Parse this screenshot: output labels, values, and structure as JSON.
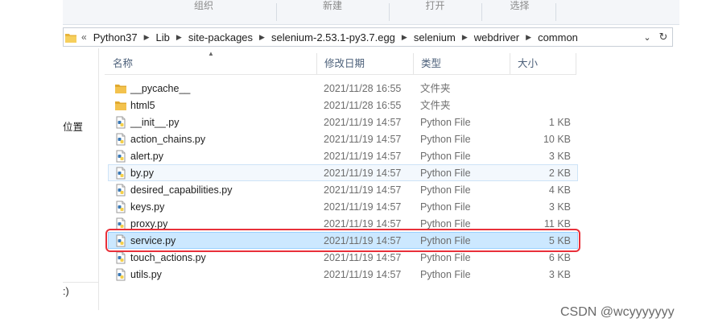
{
  "ribbon": {
    "groups": [
      {
        "label": "组织"
      },
      {
        "label": "新建"
      },
      {
        "label": "打开"
      },
      {
        "label": "选择"
      }
    ]
  },
  "addressbar": {
    "prefix": "«",
    "crumbs": [
      "Python37",
      "Lib",
      "site-packages",
      "selenium-2.53.1-py3.7.egg",
      "selenium",
      "webdriver",
      "common"
    ],
    "dropdown_glyph": "⌄",
    "refresh_glyph": "↻"
  },
  "nav": {
    "partial_label_1": "位置",
    "partial_label_2": ":)"
  },
  "columns": {
    "name": "名称",
    "date": "修改日期",
    "type": "类型",
    "size": "大小"
  },
  "files": [
    {
      "icon": "folder-icon",
      "name": "__pycache__",
      "date": "2021/11/28 16:55",
      "type": "文件夹",
      "size": ""
    },
    {
      "icon": "folder-icon",
      "name": "html5",
      "date": "2021/11/28 16:55",
      "type": "文件夹",
      "size": ""
    },
    {
      "icon": "python-file-icon",
      "name": "__init__.py",
      "date": "2021/11/19 14:57",
      "type": "Python File",
      "size": "1 KB"
    },
    {
      "icon": "python-file-icon",
      "name": "action_chains.py",
      "date": "2021/11/19 14:57",
      "type": "Python File",
      "size": "10 KB"
    },
    {
      "icon": "python-file-icon",
      "name": "alert.py",
      "date": "2021/11/19 14:57",
      "type": "Python File",
      "size": "3 KB"
    },
    {
      "icon": "python-file-icon",
      "name": "by.py",
      "date": "2021/11/19 14:57",
      "type": "Python File",
      "size": "2 KB"
    },
    {
      "icon": "python-file-icon",
      "name": "desired_capabilities.py",
      "date": "2021/11/19 14:57",
      "type": "Python File",
      "size": "4 KB"
    },
    {
      "icon": "python-file-icon",
      "name": "keys.py",
      "date": "2021/11/19 14:57",
      "type": "Python File",
      "size": "3 KB"
    },
    {
      "icon": "python-file-icon",
      "name": "proxy.py",
      "date": "2021/11/19 14:57",
      "type": "Python File",
      "size": "11 KB"
    },
    {
      "icon": "python-file-icon",
      "name": "service.py",
      "date": "2021/11/19 14:57",
      "type": "Python File",
      "size": "5 KB"
    },
    {
      "icon": "python-file-icon",
      "name": "touch_actions.py",
      "date": "2021/11/19 14:57",
      "type": "Python File",
      "size": "6 KB"
    },
    {
      "icon": "python-file-icon",
      "name": "utils.py",
      "date": "2021/11/19 14:57",
      "type": "Python File",
      "size": "3 KB"
    }
  ],
  "selected_file": "service.py",
  "hovered_file": "by.py",
  "colors": {
    "selection_bg": "#cce8ff",
    "selection_border": "#99d1ff",
    "annotation_red": "#e8303a",
    "folder_yellow": "#f3c24d",
    "python_blue": "#3a78b5",
    "python_yellow": "#f5d04a"
  },
  "watermark": "CSDN @wcyyyyyyy"
}
